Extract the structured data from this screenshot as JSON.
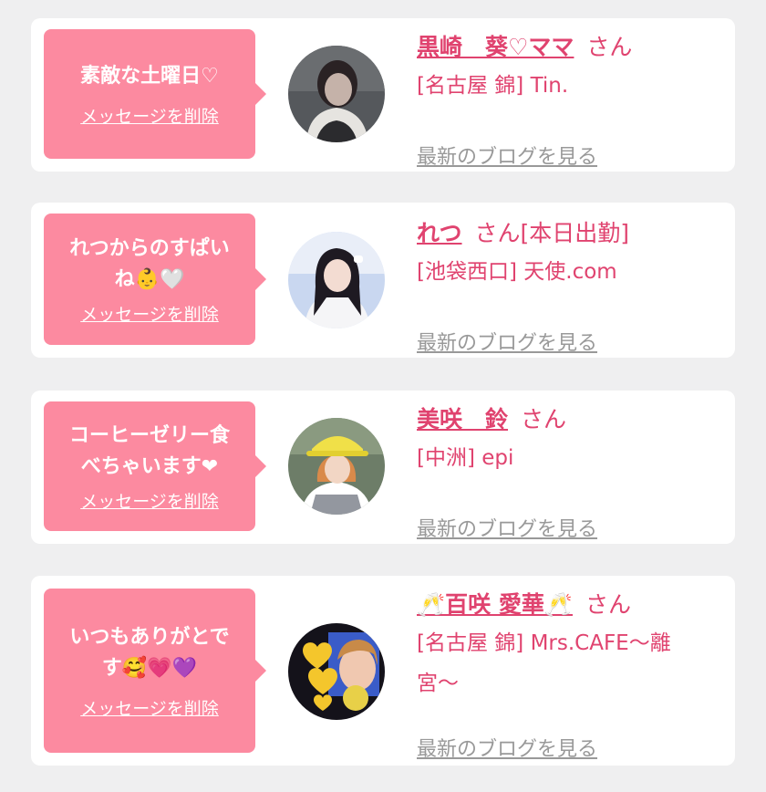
{
  "colors": {
    "background": "#efeff0",
    "card": "#ffffff",
    "bubble": "#fc8aa0",
    "accent": "#e0436f",
    "muted": "#999999"
  },
  "delete_label": "メッセージを削除",
  "blog_label": "最新のブログを見る",
  "san_suffix": "さん",
  "messages": [
    {
      "message_line1": "素敵な土曜日♡",
      "message_line2": "",
      "name": "黒崎　葵♡ママ",
      "name_suffix": "さん",
      "shop_line1": "[名古屋 錦] Tin.",
      "shop_line2": ""
    },
    {
      "message_line1": "れつからのすぱい",
      "message_line2": "ね👶🤍",
      "name": "れつ",
      "name_suffix": "さん[本日出勤]",
      "shop_line1": "[池袋西口] 天使.com",
      "shop_line2": ""
    },
    {
      "message_line1": "コーヒーゼリー食",
      "message_line2": "べちゃいます❤",
      "name": "美咲　鈴",
      "name_suffix": "さん",
      "shop_line1": "[中洲] epi",
      "shop_line2": ""
    },
    {
      "message_line1": "いつもありがとで",
      "message_line2": "す🥰💗💜",
      "name": "🥂百咲 愛華🥂",
      "name_suffix": "さん",
      "shop_line1": "[名古屋 錦] Mrs.CAFE〜離",
      "shop_line2": "宮〜"
    }
  ]
}
